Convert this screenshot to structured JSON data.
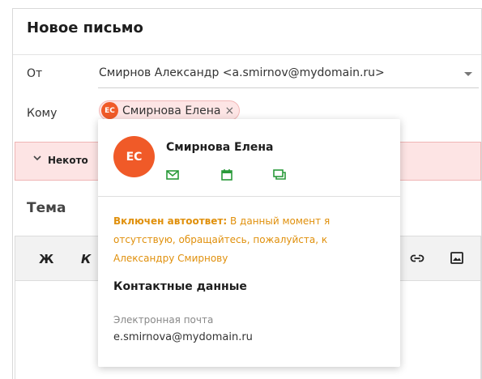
{
  "compose": {
    "title": "Новое письмо",
    "from_label": "От",
    "from_value": "Смирнов Александр <a.smirnov@mydomain.ru>",
    "to_label": "Кому",
    "recipient": {
      "initials": "ЕС",
      "name": "Смирнова Елена",
      "remove": "×"
    },
    "alert_text": "Некото",
    "subject_label": "Тема"
  },
  "toolbar": {
    "bold": "Ж",
    "italic": "К"
  },
  "popover": {
    "initials": "ЕС",
    "name": "Смирнова Елена",
    "autoreply_label": "Включен автоответ:",
    "autoreply_text": "В данный момент я отсутствую, обращайтесь, пожалуйста, к Александру Смирнову",
    "contacts_heading": "Контактные данные",
    "email_label": "Электронная почта",
    "email_value": "e.smirnova@mydomain.ru"
  },
  "colors": {
    "accent": "#f05a28",
    "chip_bg": "#fde5e5",
    "alert_bg": "#fde4e4",
    "autoreply": "#e0900c",
    "action_icons": "#2a9a3a"
  },
  "icons": [
    "dropdown-arrow-icon",
    "close-icon",
    "chevron-down-icon",
    "mail-icon",
    "calendar-icon",
    "chat-icon",
    "link-icon",
    "image-icon"
  ]
}
